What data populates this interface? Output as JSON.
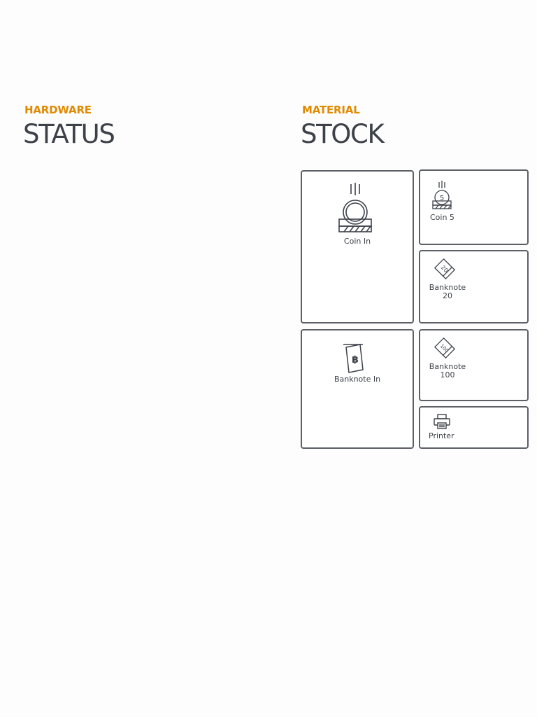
{
  "hardware": {
    "eyebrow": "HARDWARE",
    "title": "STATUS"
  },
  "material": {
    "eyebrow": "MATERIAL",
    "title": "STOCK",
    "tiles": [
      {
        "label": "Coin In",
        "icon": "coin-insert-icon"
      },
      {
        "label": "Coin 5",
        "icon": "coin-5-icon"
      },
      {
        "label_line1": "Banknote",
        "label_line2": "20",
        "icon": "banknote-20-icon"
      },
      {
        "label": "Banknote In",
        "icon": "banknote-insert-icon",
        "icon_glyph": "฿"
      },
      {
        "label_line1": "Banknote",
        "label_line2": "100",
        "icon": "banknote-100-icon"
      },
      {
        "label": "Printer",
        "icon": "printer-icon"
      }
    ]
  },
  "colors": {
    "accent": "#e08a00",
    "text": "#3d4149",
    "border": "#5b5f66",
    "background": "#fdfdfd"
  }
}
